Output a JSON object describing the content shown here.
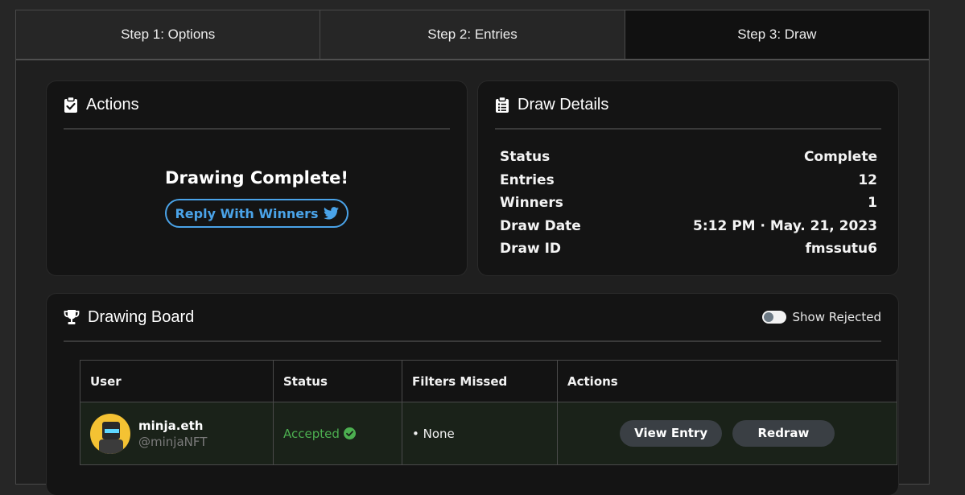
{
  "tabs": [
    {
      "label": "Step 1: Options",
      "active": false
    },
    {
      "label": "Step 2: Entries",
      "active": false
    },
    {
      "label": "Step 3: Draw",
      "active": true
    }
  ],
  "actions": {
    "title": "Actions",
    "icon": "clipboard-check-icon",
    "status_heading": "Drawing Complete!",
    "reply_button": "Reply With Winners",
    "reply_icon": "twitter-icon"
  },
  "details": {
    "title": "Draw Details",
    "icon": "clipboard-list-icon",
    "rows": [
      {
        "label": "Status",
        "value": "Complete"
      },
      {
        "label": "Entries",
        "value": "12"
      },
      {
        "label": "Winners",
        "value": "1"
      },
      {
        "label": "Draw Date",
        "value": "5:12 PM · May. 21, 2023"
      },
      {
        "label": "Draw ID",
        "value": "fmssutu6"
      }
    ]
  },
  "board": {
    "title": "Drawing Board",
    "icon": "trophy-icon",
    "toggle_label": "Show Rejected",
    "toggle_on": false,
    "columns": [
      "User",
      "Status",
      "Filters Missed",
      "Actions"
    ],
    "rows": [
      {
        "name": "minja.eth",
        "handle": "@minjaNFT",
        "status": "Accepted",
        "filters_missed": "• None",
        "view_label": "View Entry",
        "redraw_label": "Redraw"
      }
    ]
  },
  "colors": {
    "accent_blue": "#4aa3e8",
    "accepted_green": "#4caf50",
    "avatar_bg": "#f4c233"
  }
}
